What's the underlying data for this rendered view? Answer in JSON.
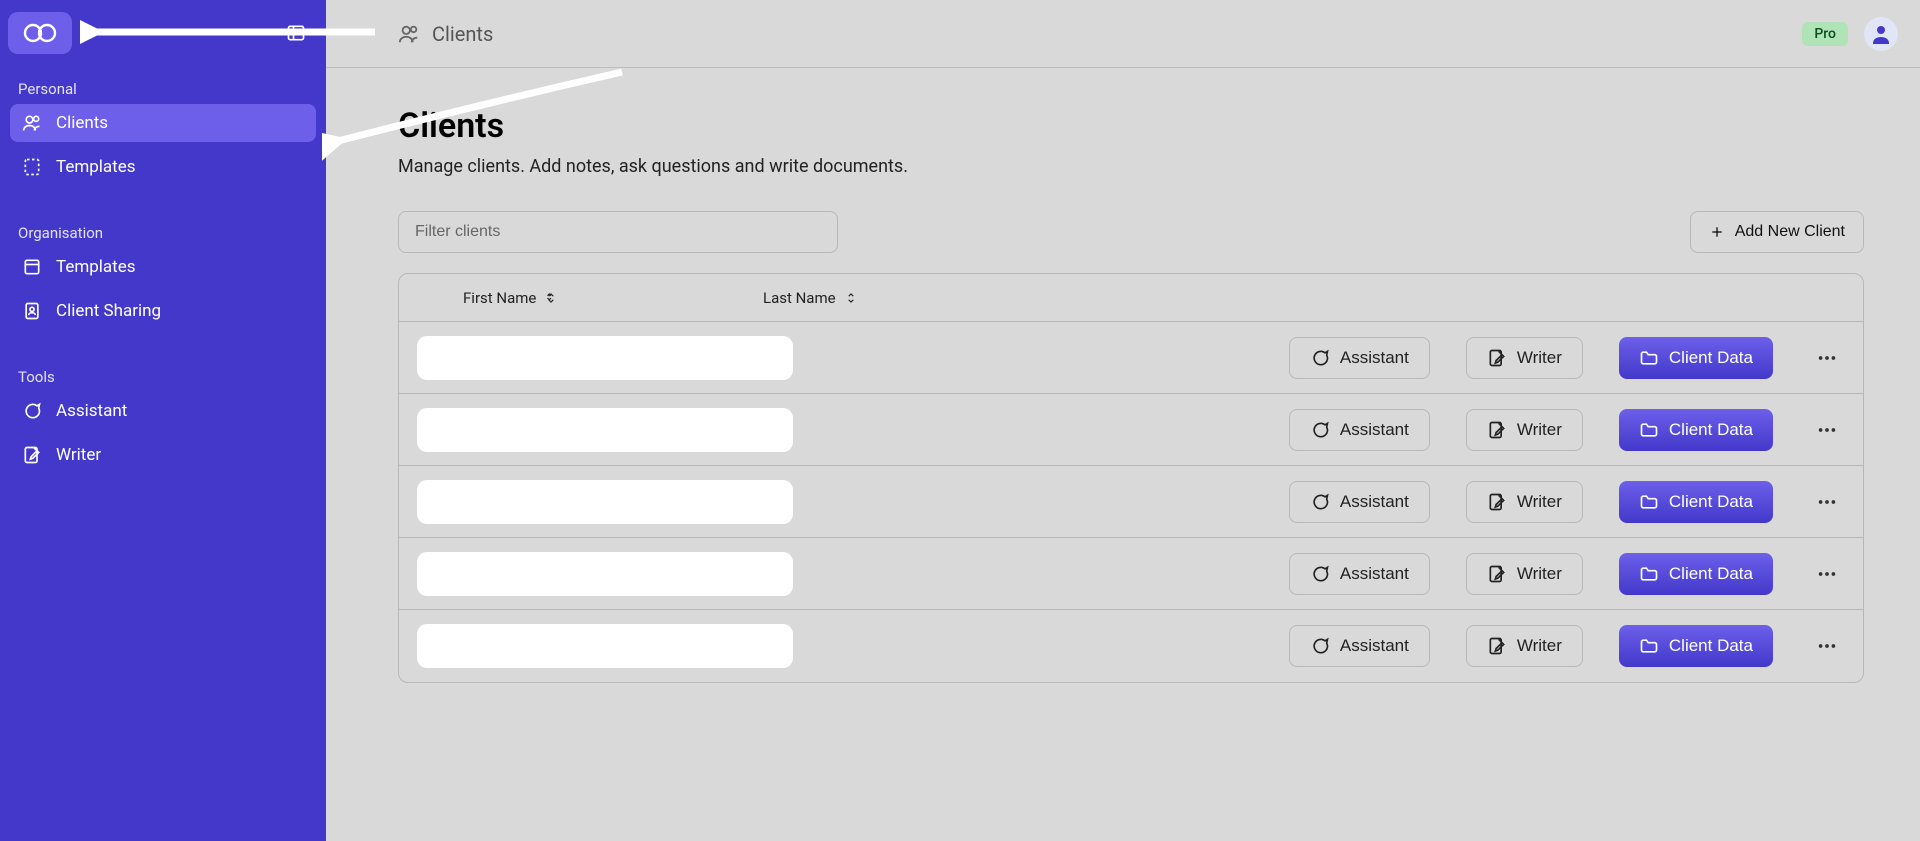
{
  "sidebar": {
    "sections": [
      {
        "label": "Personal",
        "items": [
          {
            "label": "Clients",
            "icon": "users-icon",
            "active": true
          },
          {
            "label": "Templates",
            "icon": "template-icon",
            "active": false
          }
        ]
      },
      {
        "label": "Organisation",
        "items": [
          {
            "label": "Templates",
            "icon": "template-square-icon",
            "active": false
          },
          {
            "label": "Client Sharing",
            "icon": "contact-icon",
            "active": false
          }
        ]
      },
      {
        "label": "Tools",
        "items": [
          {
            "label": "Assistant",
            "icon": "chat-icon",
            "active": false
          },
          {
            "label": "Writer",
            "icon": "writer-icon",
            "active": false
          }
        ]
      }
    ]
  },
  "topbar": {
    "title": "Clients",
    "badge": "Pro"
  },
  "page": {
    "title": "Clients",
    "subtitle": "Manage clients. Add notes, ask questions and write documents.",
    "filter_placeholder": "Filter clients",
    "add_button": "Add New Client"
  },
  "table": {
    "columns": [
      {
        "label": "First Name"
      },
      {
        "label": "Last Name"
      }
    ],
    "row_buttons": {
      "assistant": "Assistant",
      "writer": "Writer",
      "client_data": "Client Data"
    },
    "rows": [
      {
        "first_name": "",
        "last_name": ""
      },
      {
        "first_name": "",
        "last_name": ""
      },
      {
        "first_name": "",
        "last_name": ""
      },
      {
        "first_name": "",
        "last_name": ""
      },
      {
        "first_name": "",
        "last_name": ""
      }
    ]
  }
}
